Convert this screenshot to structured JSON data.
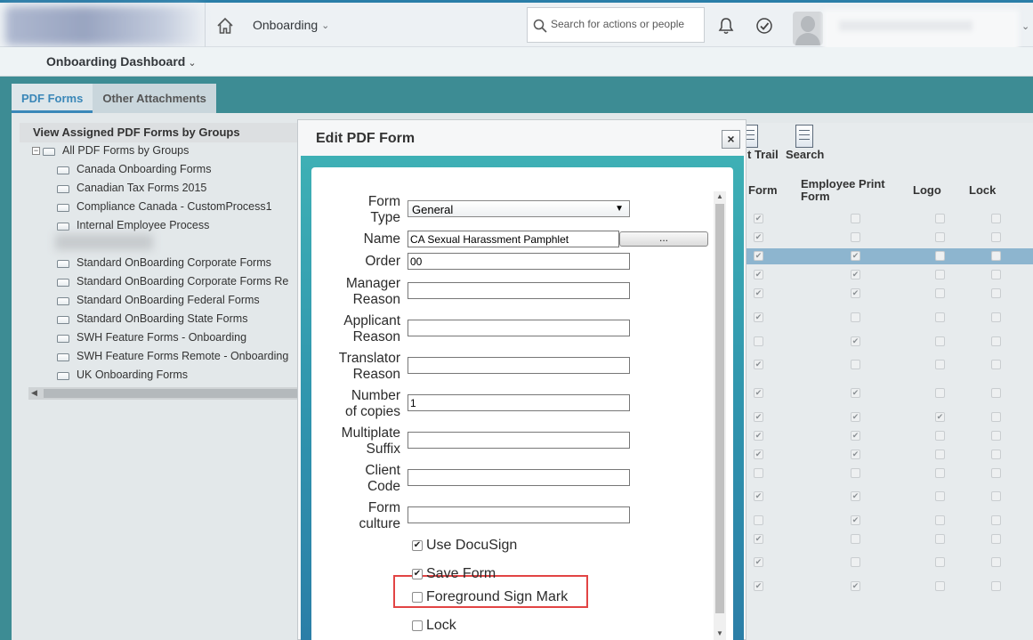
{
  "shell": {
    "module_menu": "Onboarding",
    "search_placeholder": "Search for actions or people"
  },
  "subheader": {
    "title": "Onboarding Dashboard"
  },
  "tabs": [
    {
      "label": "PDF Forms",
      "active": true
    },
    {
      "label": "Other Attachments",
      "active": false
    }
  ],
  "tree": {
    "title": "View Assigned PDF Forms by Groups",
    "root": "All PDF Forms by Groups",
    "items": [
      "Canada Onboarding Forms",
      "Canadian Tax Forms 2015",
      "Compliance Canada - CustomProcess1",
      "Internal Employee Process",
      "Standard OnBoarding Corporate Forms",
      "Standard OnBoarding Corporate Forms Re",
      "Standard OnBoarding Federal Forms",
      "Standard OnBoarding State Forms",
      "SWH Feature Forms - Onboarding",
      "SWH Feature Forms Remote - Onboarding",
      "UK Onboarding Forms"
    ]
  },
  "grid": {
    "toolbar": {
      "trail_label": "t Trail",
      "search_label": "Search"
    },
    "columns": {
      "form": "Form",
      "employee_print_form": "Employee Print Form",
      "logo": "Logo",
      "lock": "Lock"
    },
    "rows": [
      {
        "form": true,
        "print": false,
        "logo": false,
        "lock": false
      },
      {
        "form": true,
        "print": false,
        "logo": false,
        "lock": false
      },
      {
        "form": true,
        "print": true,
        "logo": false,
        "lock": false,
        "selected": true
      },
      {
        "form": true,
        "print": true,
        "logo": false,
        "lock": false
      },
      {
        "form": true,
        "print": true,
        "logo": false,
        "lock": false
      },
      {
        "form": true,
        "print": false,
        "logo": false,
        "lock": false
      },
      {
        "form": false,
        "print": true,
        "logo": false,
        "lock": false
      },
      {
        "form": true,
        "print": false,
        "logo": false,
        "lock": false
      },
      {
        "form": true,
        "print": true,
        "logo": false,
        "lock": false
      },
      {
        "form": true,
        "print": true,
        "logo": true,
        "lock": false
      },
      {
        "form": true,
        "print": true,
        "logo": false,
        "lock": false
      },
      {
        "form": true,
        "print": true,
        "logo": false,
        "lock": false
      },
      {
        "form": false,
        "print": false,
        "logo": false,
        "lock": false
      },
      {
        "form": true,
        "print": true,
        "logo": false,
        "lock": false
      },
      {
        "form": false,
        "print": true,
        "logo": false,
        "lock": false
      },
      {
        "form": true,
        "print": false,
        "logo": false,
        "lock": false
      },
      {
        "form": true,
        "print": false,
        "logo": false,
        "lock": false
      },
      {
        "form": true,
        "print": true,
        "logo": false,
        "lock": false
      }
    ]
  },
  "modal": {
    "title": "Edit PDF Form",
    "close_label": "×",
    "fields": {
      "form_type": {
        "label_1": "Form",
        "label_2": "Type",
        "value": "General"
      },
      "name": {
        "label": "Name",
        "value": "CA Sexual Harassment Pamphlet",
        "browse_label": "..."
      },
      "order": {
        "label": "Order",
        "value": "00"
      },
      "manager_reason": {
        "label_1": "Manager",
        "label_2": "Reason",
        "value": ""
      },
      "applicant_reason": {
        "label_1": "Applicant",
        "label_2": "Reason",
        "value": ""
      },
      "translator_reason": {
        "label_1": "Translator",
        "label_2": "Reason",
        "value": ""
      },
      "number_of_copies": {
        "label_1": "Number",
        "label_2": "of copies",
        "value": "1"
      },
      "multiplate_suffix": {
        "label_1": "Multiplate",
        "label_2": "Suffix",
        "value": ""
      },
      "client_code": {
        "label_1": "Client",
        "label_2": "Code",
        "value": ""
      },
      "form_culture": {
        "label_1": "Form",
        "label_2": "culture",
        "value": ""
      }
    },
    "checkboxes": {
      "use_docusign": {
        "label": "Use DocuSign",
        "checked": true
      },
      "save_form": {
        "label": "Save Form",
        "checked": true
      },
      "foreground_sign_mark": {
        "label": "Foreground Sign Mark",
        "checked": false
      },
      "lock": {
        "label": "Lock",
        "checked": false
      }
    },
    "highlight_color": "#e24444"
  }
}
